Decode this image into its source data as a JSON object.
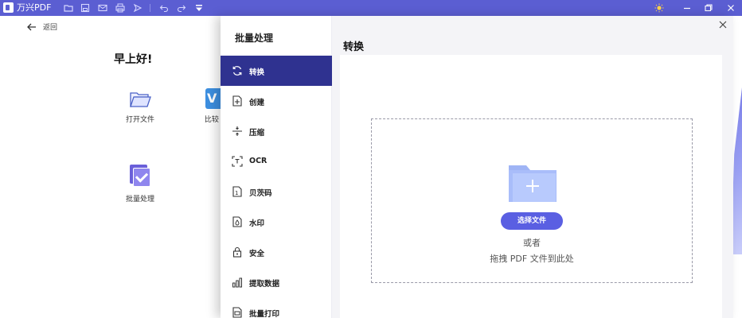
{
  "app": {
    "title": "万兴PDF",
    "toolbar_icons": [
      "folder-icon",
      "save-icon",
      "mail-icon",
      "print-icon",
      "share-icon",
      "undo-icon",
      "redo-icon",
      "dropdown-icon"
    ],
    "window_icons": [
      "theme-icon",
      "minimize-icon",
      "restore-icon",
      "close-icon"
    ],
    "accent_color": "#5b5ed2"
  },
  "home": {
    "back_label": "返回",
    "greeting": "早上好!",
    "tiles": [
      {
        "label": "打开文件",
        "icon": "open-folder-icon"
      },
      {
        "label": "比较 P",
        "icon": "compare-icon",
        "icon_text": "V"
      },
      {
        "label": "批量处理",
        "icon": "batch-icon"
      }
    ]
  },
  "dialog": {
    "sidebar_title": "批量处理",
    "items": [
      {
        "label": "转换",
        "icon": "convert-icon",
        "active": true
      },
      {
        "label": "创建",
        "icon": "create-icon",
        "active": false
      },
      {
        "label": "压缩",
        "icon": "compress-icon",
        "active": false
      },
      {
        "label": "OCR",
        "icon": "ocr-icon",
        "active": false
      },
      {
        "label": "贝茨码",
        "icon": "bates-icon",
        "active": false
      },
      {
        "label": "水印",
        "icon": "watermark-icon",
        "active": false
      },
      {
        "label": "安全",
        "icon": "lock-icon",
        "active": false
      },
      {
        "label": "提取数据",
        "icon": "chart-icon",
        "active": false
      },
      {
        "label": "批量打印",
        "icon": "print-icon",
        "active": false
      }
    ],
    "main_title": "转换",
    "select_button": "选择文件",
    "or_text": "或者",
    "drag_text": "拖拽 PDF 文件到此处",
    "active_color": "#2f3290",
    "button_color": "#5a5fe2"
  }
}
